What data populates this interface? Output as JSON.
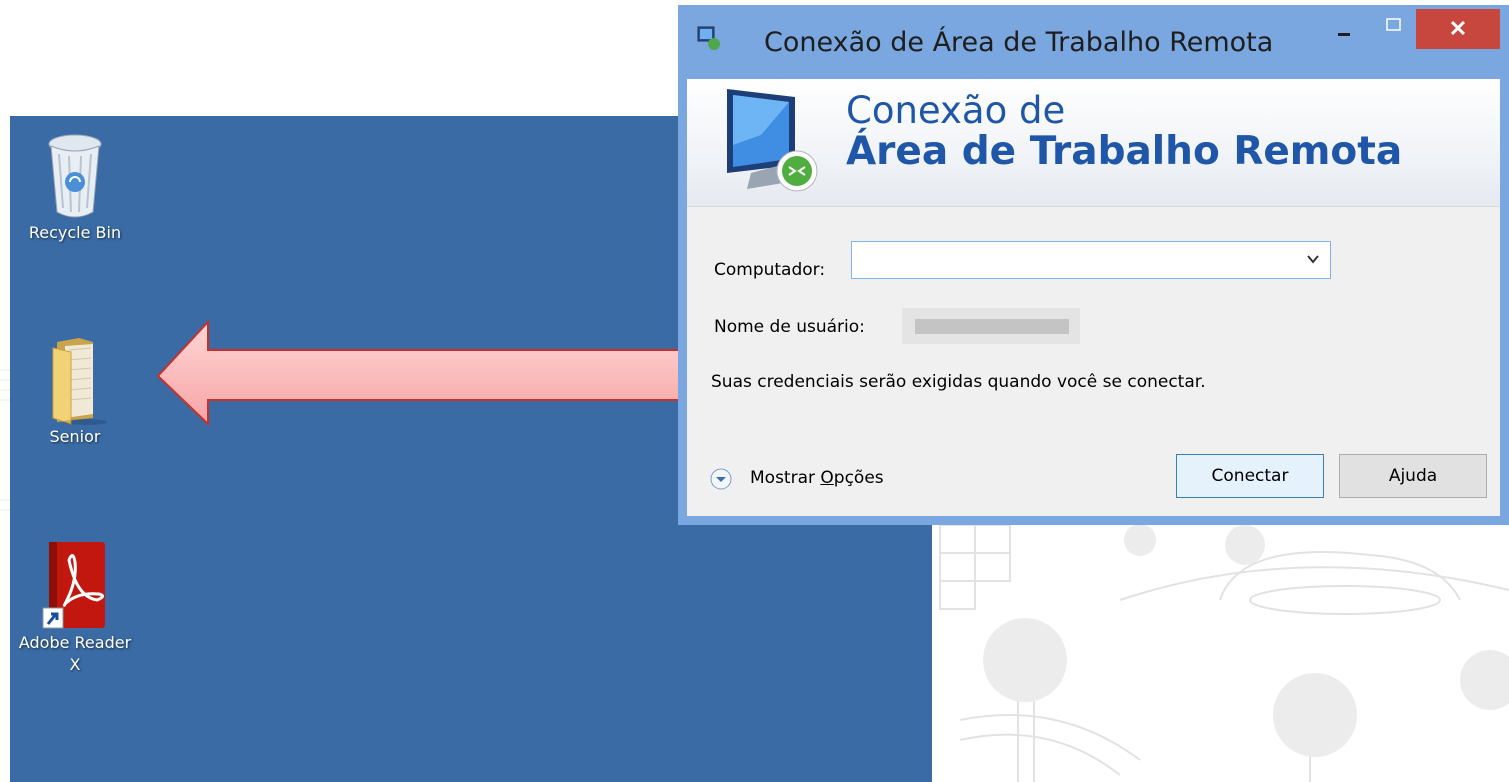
{
  "desktop": {
    "icons": [
      {
        "label": "Recycle Bin"
      },
      {
        "label": "Senior"
      },
      {
        "label_line1": "Adobe Reader",
        "label_line2": "X"
      }
    ]
  },
  "window": {
    "title": "Conexão de Área de Trabalho Remota",
    "close_label": "✕",
    "banner_line1": "Conexão de",
    "banner_line2": "Área de Trabalho Remota",
    "computer_label": "Computador:",
    "computer_value": "",
    "user_label": "Nome de usuário:",
    "info_text": "Suas credenciais serão exigidas quando você se conectar.",
    "options_prefix": "Mostrar ",
    "options_underlined": "O",
    "options_suffix": "pções",
    "connect_label": "Conectar",
    "help_label": "Ajuda"
  },
  "colors": {
    "desktop": "#3a6ba5",
    "window_frame": "#7aa7df",
    "close_button": "#c7463d",
    "banner_title": "#1f56a8"
  },
  "icons": [
    "recycle-bin-icon",
    "folder-icon",
    "adobe-reader-icon",
    "shortcut-arrow-icon",
    "remote-desktop-icon",
    "chevron-down-icon",
    "expand-options-icon",
    "annotation-arrow"
  ]
}
